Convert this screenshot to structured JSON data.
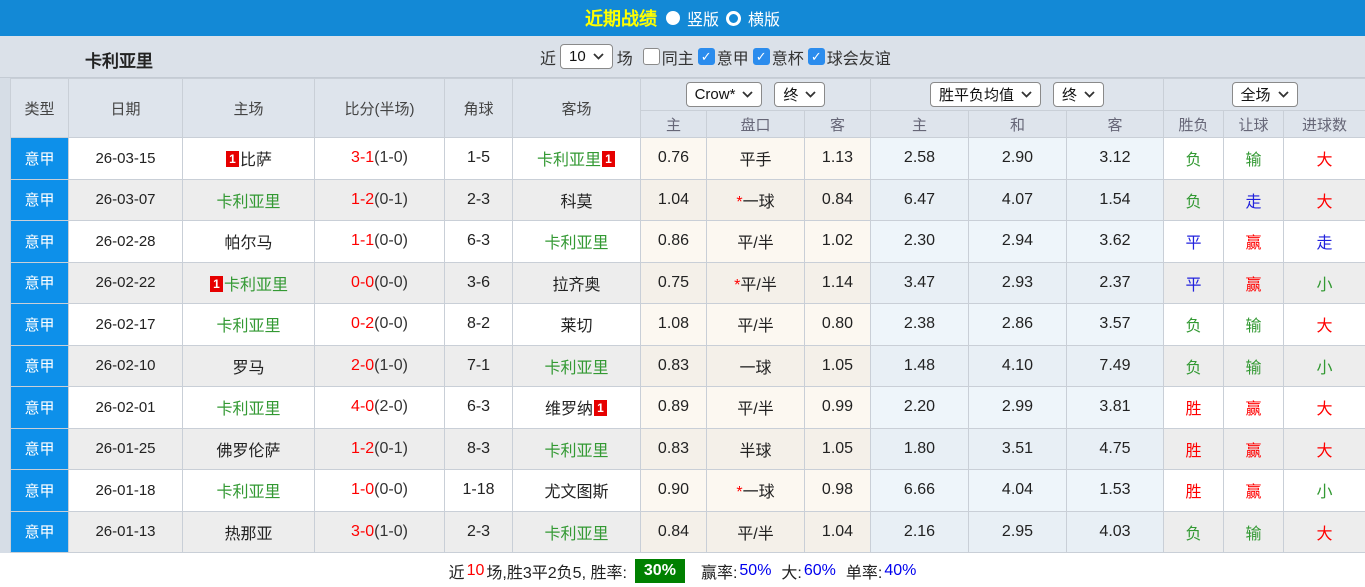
{
  "topbar": {
    "title": "近期战绩",
    "radios": [
      {
        "label": "竖版",
        "selected": true
      },
      {
        "label": "横版",
        "selected": false
      }
    ],
    "bg_color": "#1389d6",
    "title_color": "#ffff00"
  },
  "filter": {
    "team": "卡利亚里",
    "near_label": "近",
    "count_value": "10",
    "games_label": "场",
    "checkboxes": [
      {
        "label": "同主",
        "checked": false
      },
      {
        "label": "意甲",
        "checked": true
      },
      {
        "label": "意杯",
        "checked": true
      },
      {
        "label": "球会友谊",
        "checked": true
      }
    ]
  },
  "table": {
    "col_headers": [
      "类型",
      "日期",
      "主场",
      "比分(半场)",
      "角球",
      "客场"
    ],
    "group1": {
      "select_company": "Crow*",
      "select_time": "终",
      "subcols": [
        "主",
        "盘口",
        "客"
      ]
    },
    "group2": {
      "select_model": "胜平负均值",
      "select_time": "终",
      "subcols": [
        "主",
        "和",
        "客"
      ]
    },
    "group3": {
      "select_scope": "全场",
      "subcols": [
        "胜负",
        "让球",
        "进球数"
      ]
    },
    "league_color": "#0d90ea",
    "rows": [
      {
        "league": "意甲",
        "date": "26-03-15",
        "home": {
          "name": "比萨",
          "color": "black",
          "rank": "1",
          "rank_pos": "before"
        },
        "score_ft": "3-1",
        "score_ht": "(1-0)",
        "corner": "1-5",
        "away": {
          "name": "卡利亚里",
          "color": "green",
          "rank": "1",
          "rank_pos": "after"
        },
        "odds": {
          "home": "0.76",
          "handicap": {
            "star": false,
            "text": "平手"
          },
          "away": "1.13"
        },
        "avg": [
          "2.58",
          "2.90",
          "3.12"
        ],
        "results": [
          {
            "t": "负",
            "c": "green"
          },
          {
            "t": "输",
            "c": "green"
          },
          {
            "t": "大",
            "c": "red"
          }
        ]
      },
      {
        "league": "意甲",
        "date": "26-03-07",
        "home": {
          "name": "卡利亚里",
          "color": "green"
        },
        "score_ft": "1-2",
        "score_ht": "(0-1)",
        "corner": "2-3",
        "away": {
          "name": "科莫",
          "color": "black"
        },
        "odds": {
          "home": "1.04",
          "handicap": {
            "star": true,
            "text": "一球"
          },
          "away": "0.84"
        },
        "avg": [
          "6.47",
          "4.07",
          "1.54"
        ],
        "results": [
          {
            "t": "负",
            "c": "green"
          },
          {
            "t": "走",
            "c": "blue"
          },
          {
            "t": "大",
            "c": "red"
          }
        ]
      },
      {
        "league": "意甲",
        "date": "26-02-28",
        "home": {
          "name": "帕尔马",
          "color": "black"
        },
        "score_ft": "1-1",
        "score_ht": "(0-0)",
        "corner": "6-3",
        "away": {
          "name": "卡利亚里",
          "color": "green"
        },
        "odds": {
          "home": "0.86",
          "handicap": {
            "star": false,
            "text": "平/半"
          },
          "away": "1.02"
        },
        "avg": [
          "2.30",
          "2.94",
          "3.62"
        ],
        "results": [
          {
            "t": "平",
            "c": "blue"
          },
          {
            "t": "赢",
            "c": "red"
          },
          {
            "t": "走",
            "c": "blue"
          }
        ]
      },
      {
        "league": "意甲",
        "date": "26-02-22",
        "home": {
          "name": "卡利亚里",
          "color": "green",
          "rank": "1",
          "rank_pos": "before"
        },
        "score_ft": "0-0",
        "score_ht": "(0-0)",
        "corner": "3-6",
        "away": {
          "name": "拉齐奥",
          "color": "black"
        },
        "odds": {
          "home": "0.75",
          "handicap": {
            "star": true,
            "text": "平/半"
          },
          "away": "1.14"
        },
        "avg": [
          "3.47",
          "2.93",
          "2.37"
        ],
        "results": [
          {
            "t": "平",
            "c": "blue"
          },
          {
            "t": "赢",
            "c": "red"
          },
          {
            "t": "小",
            "c": "green"
          }
        ]
      },
      {
        "league": "意甲",
        "date": "26-02-17",
        "home": {
          "name": "卡利亚里",
          "color": "green"
        },
        "score_ft": "0-2",
        "score_ht": "(0-0)",
        "corner": "8-2",
        "away": {
          "name": "莱切",
          "color": "black"
        },
        "odds": {
          "home": "1.08",
          "handicap": {
            "star": false,
            "text": "平/半"
          },
          "away": "0.80"
        },
        "avg": [
          "2.38",
          "2.86",
          "3.57"
        ],
        "results": [
          {
            "t": "负",
            "c": "green"
          },
          {
            "t": "输",
            "c": "green"
          },
          {
            "t": "大",
            "c": "red"
          }
        ]
      },
      {
        "league": "意甲",
        "date": "26-02-10",
        "home": {
          "name": "罗马",
          "color": "black"
        },
        "score_ft": "2-0",
        "score_ht": "(1-0)",
        "corner": "7-1",
        "away": {
          "name": "卡利亚里",
          "color": "green"
        },
        "odds": {
          "home": "0.83",
          "handicap": {
            "star": false,
            "text": "一球"
          },
          "away": "1.05"
        },
        "avg": [
          "1.48",
          "4.10",
          "7.49"
        ],
        "results": [
          {
            "t": "负",
            "c": "green"
          },
          {
            "t": "输",
            "c": "green"
          },
          {
            "t": "小",
            "c": "green"
          }
        ]
      },
      {
        "league": "意甲",
        "date": "26-02-01",
        "home": {
          "name": "卡利亚里",
          "color": "green"
        },
        "score_ft": "4-0",
        "score_ht": "(2-0)",
        "corner": "6-3",
        "away": {
          "name": "维罗纳",
          "color": "black",
          "rank": "1",
          "rank_pos": "after"
        },
        "odds": {
          "home": "0.89",
          "handicap": {
            "star": false,
            "text": "平/半"
          },
          "away": "0.99"
        },
        "avg": [
          "2.20",
          "2.99",
          "3.81"
        ],
        "results": [
          {
            "t": "胜",
            "c": "red"
          },
          {
            "t": "赢",
            "c": "red"
          },
          {
            "t": "大",
            "c": "red"
          }
        ]
      },
      {
        "league": "意甲",
        "date": "26-01-25",
        "home": {
          "name": "佛罗伦萨",
          "color": "black"
        },
        "score_ft": "1-2",
        "score_ht": "(0-1)",
        "corner": "8-3",
        "away": {
          "name": "卡利亚里",
          "color": "green"
        },
        "odds": {
          "home": "0.83",
          "handicap": {
            "star": false,
            "text": "半球"
          },
          "away": "1.05"
        },
        "avg": [
          "1.80",
          "3.51",
          "4.75"
        ],
        "results": [
          {
            "t": "胜",
            "c": "red"
          },
          {
            "t": "赢",
            "c": "red"
          },
          {
            "t": "大",
            "c": "red"
          }
        ]
      },
      {
        "league": "意甲",
        "date": "26-01-18",
        "home": {
          "name": "卡利亚里",
          "color": "green"
        },
        "score_ft": "1-0",
        "score_ht": "(0-0)",
        "corner": "1-18",
        "away": {
          "name": "尤文图斯",
          "color": "black"
        },
        "odds": {
          "home": "0.90",
          "handicap": {
            "star": true,
            "text": "一球"
          },
          "away": "0.98"
        },
        "avg": [
          "6.66",
          "4.04",
          "1.53"
        ],
        "results": [
          {
            "t": "胜",
            "c": "red"
          },
          {
            "t": "赢",
            "c": "red"
          },
          {
            "t": "小",
            "c": "green"
          }
        ]
      },
      {
        "league": "意甲",
        "date": "26-01-13",
        "home": {
          "name": "热那亚",
          "color": "black"
        },
        "score_ft": "3-0",
        "score_ht": "(1-0)",
        "corner": "2-3",
        "away": {
          "name": "卡利亚里",
          "color": "green"
        },
        "odds": {
          "home": "0.84",
          "handicap": {
            "star": false,
            "text": "平/半"
          },
          "away": "1.04"
        },
        "avg": [
          "2.16",
          "2.95",
          "4.03"
        ],
        "results": [
          {
            "t": "负",
            "c": "green"
          },
          {
            "t": "输",
            "c": "green"
          },
          {
            "t": "大",
            "c": "red"
          }
        ]
      }
    ]
  },
  "summary": {
    "near_label": "近",
    "count": "10",
    "record": "场,胜3平2负5, 胜率:",
    "win_rate": "30%",
    "odds_win_label": "赢率:",
    "odds_win_value": "50%",
    "big_label": "大:",
    "big_value": "60%",
    "single_label": "单率:",
    "single_value": "40%",
    "win_rate_bg": "#008000"
  }
}
